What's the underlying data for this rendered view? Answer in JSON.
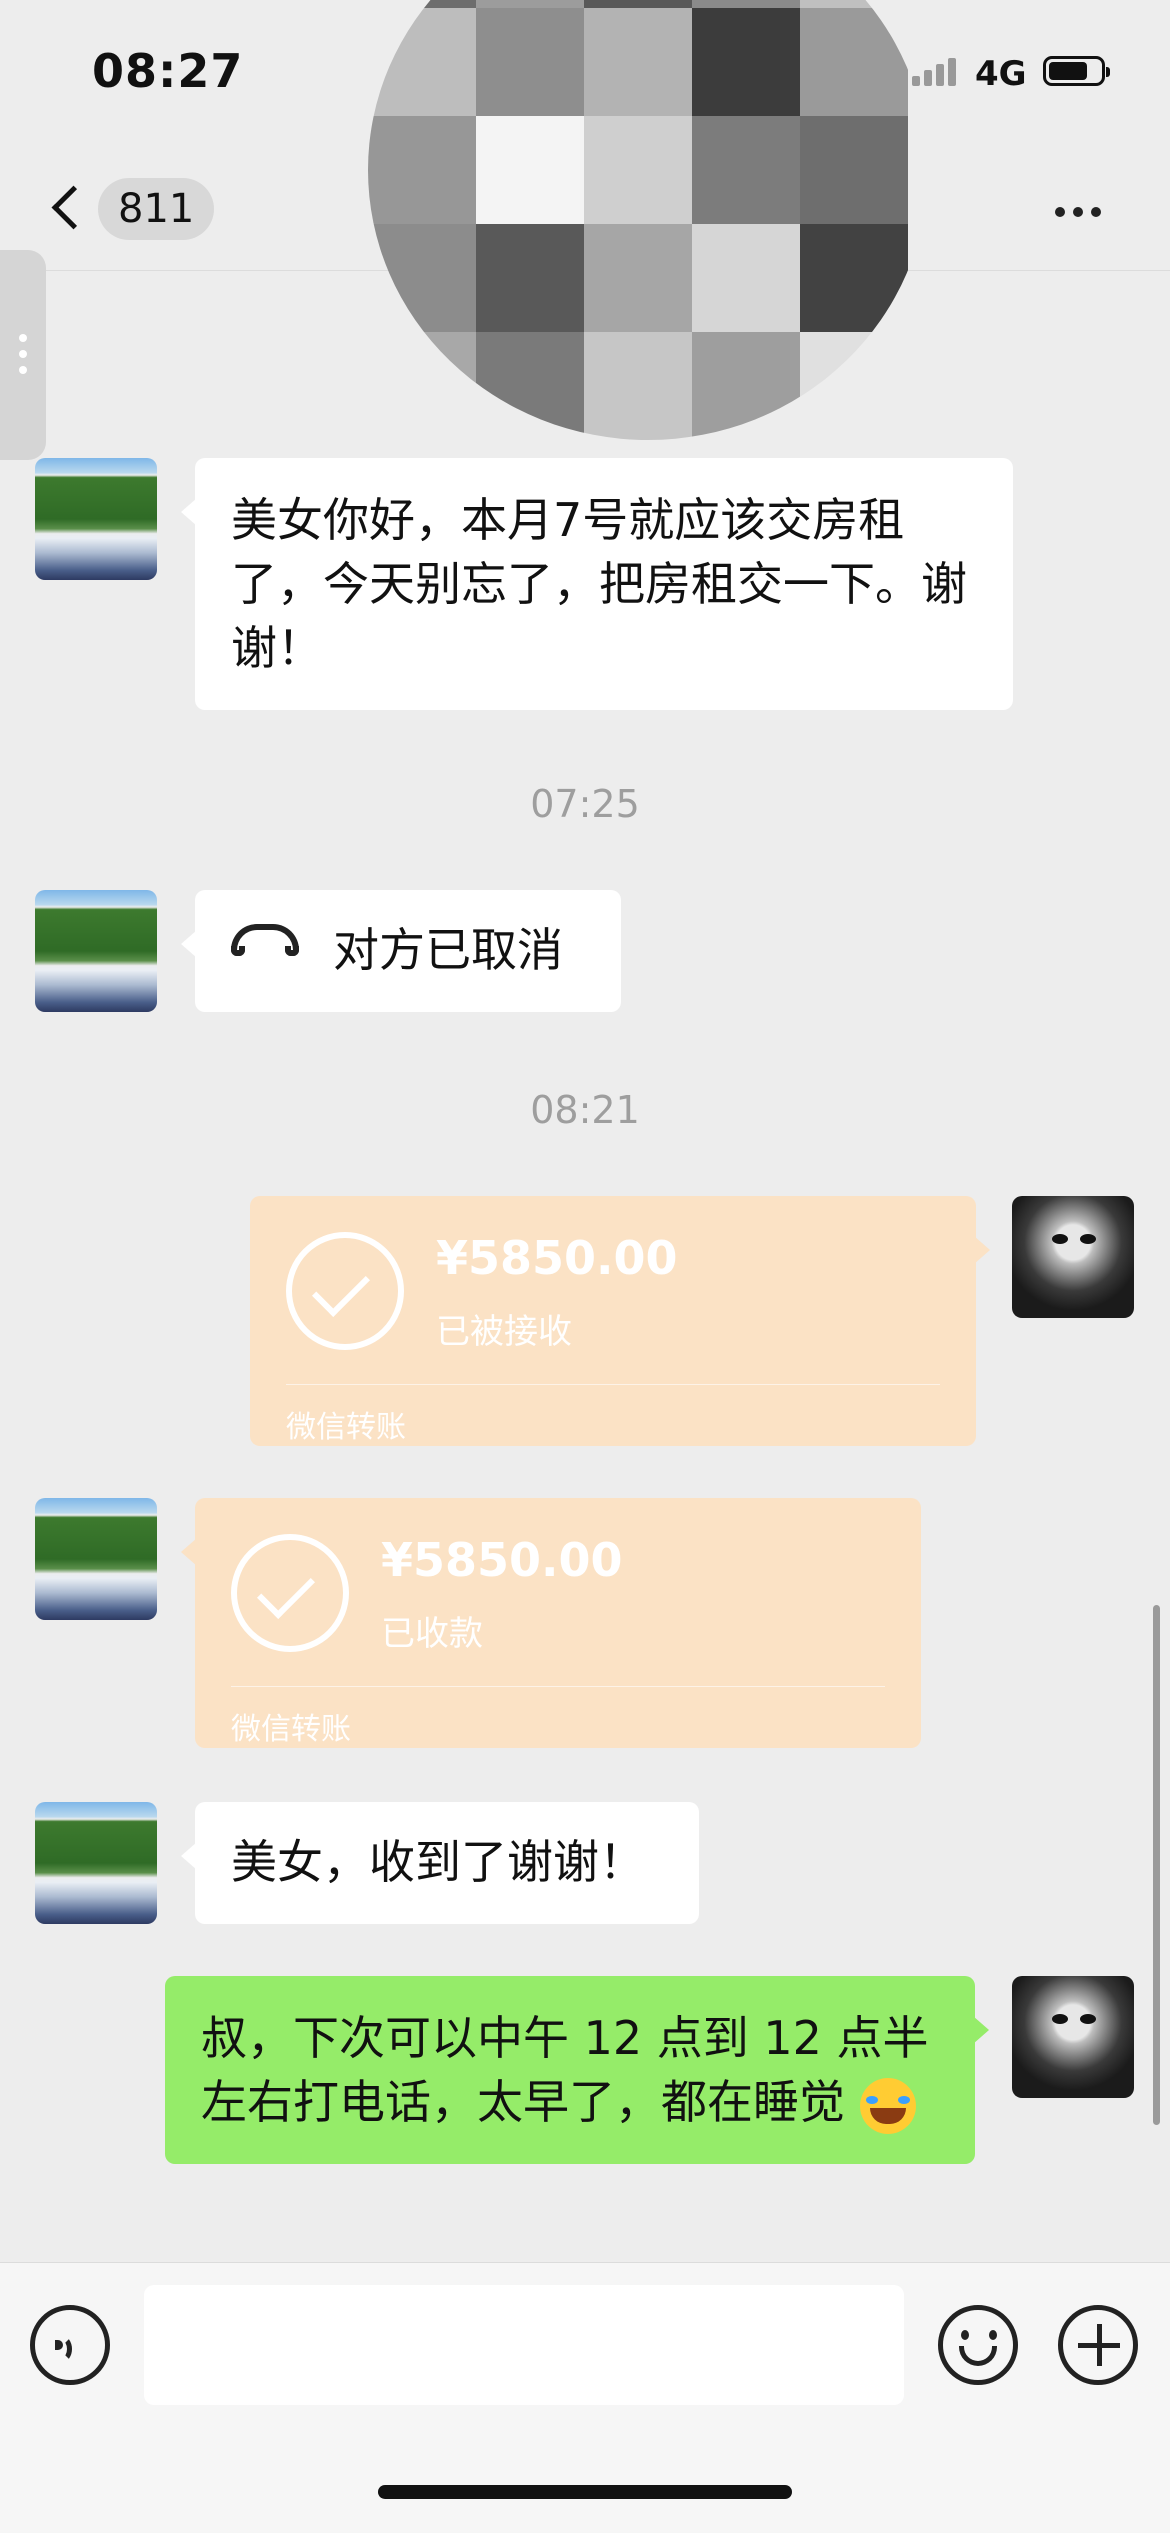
{
  "status_bar": {
    "time": "08:27",
    "network": "4G"
  },
  "nav": {
    "unread_count": "811"
  },
  "messages": [
    {
      "side": "left",
      "type": "text",
      "text": "美女你好，本月7号就应该交房租了，今天别忘了，把房租交一下。谢谢！"
    },
    {
      "type": "timestamp",
      "text": "07:25"
    },
    {
      "side": "left",
      "type": "call",
      "text": "对方已取消",
      "icon": "hangup-phone-icon"
    },
    {
      "type": "timestamp",
      "text": "08:21"
    },
    {
      "side": "right",
      "type": "transfer",
      "amount": "¥5850.00",
      "status": "已被接收",
      "footer": "微信转账"
    },
    {
      "side": "left",
      "type": "transfer",
      "amount": "¥5850.00",
      "status": "已收款",
      "footer": "微信转账"
    },
    {
      "side": "left",
      "type": "text",
      "text": "美女，收到了谢谢！"
    },
    {
      "side": "right",
      "type": "text",
      "text": "叔，下次可以中午 12 点到 12 点半左右打电话，太早了，都在睡觉",
      "emoji": "face-with-hand-over-mouth-emoji"
    }
  ],
  "colors": {
    "background": "#ededed",
    "sent_bubble": "#95ec69",
    "received_bubble": "#ffffff",
    "transfer_bubble": "#fbe2c5"
  },
  "input_bar": {
    "icons": [
      "voice-icon",
      "emoji-icon",
      "plus-icon"
    ]
  }
}
